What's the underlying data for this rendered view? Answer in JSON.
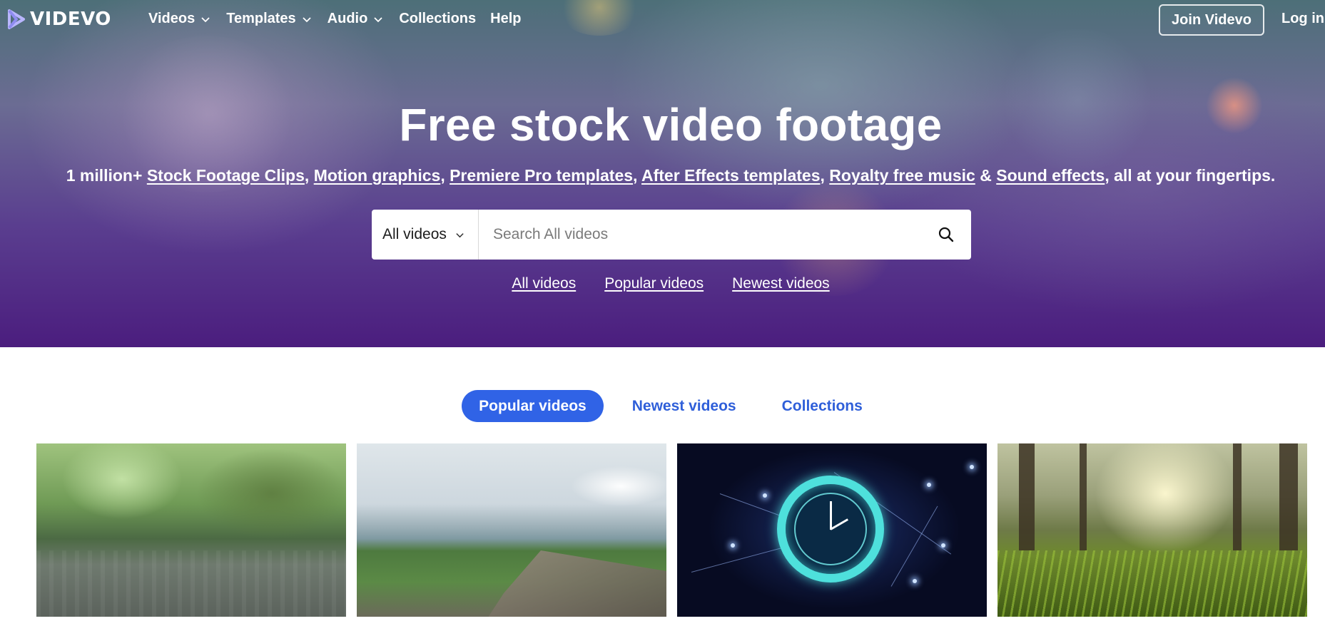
{
  "nav": {
    "logo_text": "VIDEVO",
    "links": [
      {
        "label": "Videos",
        "has_dropdown": true
      },
      {
        "label": "Templates",
        "has_dropdown": true
      },
      {
        "label": "Audio",
        "has_dropdown": true
      },
      {
        "label": "Collections",
        "has_dropdown": false
      },
      {
        "label": "Help",
        "has_dropdown": false
      }
    ],
    "join_label": "Join Videvo",
    "login_label": "Log in"
  },
  "hero": {
    "title": "Free stock video footage",
    "subtitle": {
      "prefix": "1 million+",
      "links": [
        "Stock Footage Clips",
        "Motion graphics",
        "Premiere Pro templates",
        "After Effects templates",
        "Royalty free music",
        "Sound effects"
      ],
      "separator": ",",
      "ampersand": "&",
      "suffix": ", all at your fingertips."
    },
    "search": {
      "category": "All videos",
      "placeholder": "Search All videos",
      "icon": "search-icon"
    },
    "quick_links": [
      "All videos",
      "Popular videos",
      "Newest videos"
    ]
  },
  "tabs": [
    {
      "label": "Popular videos",
      "active": true
    },
    {
      "label": "Newest videos",
      "active": false
    },
    {
      "label": "Collections",
      "active": false
    }
  ],
  "thumbnails": [
    {
      "subject": "rain-on-puddle"
    },
    {
      "subject": "rocky-coastline"
    },
    {
      "subject": "glowing-clock-network"
    },
    {
      "subject": "sunlit-forest-grass"
    }
  ],
  "colors": {
    "accent": "#3063e6",
    "tab_link": "#2f5fd9",
    "hero_top": "#4d6f78",
    "hero_bottom": "#4b1d7e"
  }
}
